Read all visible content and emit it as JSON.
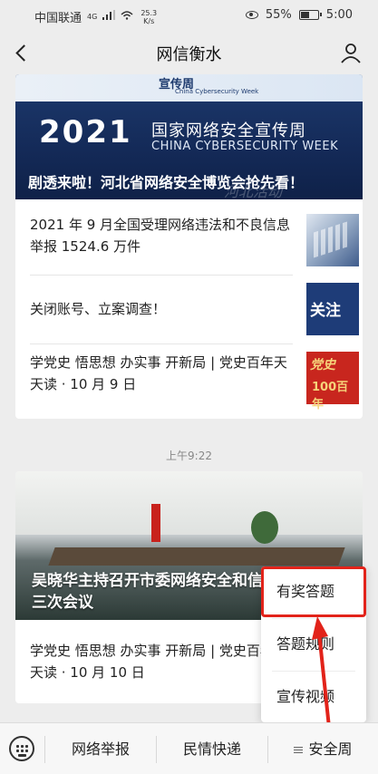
{
  "status_bar": {
    "carrier": "中国联通",
    "network": "4G",
    "speed_value": "25.3",
    "speed_unit": "K/s",
    "battery": "55%",
    "battery_level": 0.55,
    "time": "5:00"
  },
  "header": {
    "title": "网信衡水",
    "back_icon": "back-arrow-icon",
    "profile_icon": "user-icon"
  },
  "card1": {
    "hero": {
      "brand_cn": "宣传周",
      "brand_en": "China Cybersecurity Week",
      "year": "2021",
      "week_cn": "国家网络安全宣传周",
      "week_en": "CHINA CYBERSECURITY WEEK",
      "caption": "剧透来啦！河北省网络安全博览会抢先看！",
      "watermark": "河北活动"
    },
    "items": [
      {
        "text": "2021 年 9 月全国受理网络违法和不良信息举报 1524.6 万件",
        "thumb": "keyboard-photo"
      },
      {
        "text": "关闭账号、立案调查！",
        "thumb": "关注"
      },
      {
        "text": "学党史 悟思想 办实事 开新局 | 党史百年天天读 · 10 月 9 日",
        "thumb_top": "党史",
        "thumb_bottom": "100百年"
      }
    ]
  },
  "timestamp": "上午9:22",
  "card2": {
    "hero_caption": "吴晓华主持召开市委网络安全和信息化委员会第三次会议",
    "items": [
      {
        "text": "学党史 悟思想 办实事 开新局 | 党史百年天天读 · 10 月 10 日"
      }
    ]
  },
  "popup_menu": {
    "items": [
      "有奖答题",
      "答题规则",
      "宣传视频"
    ],
    "highlight_color": "#e2231a"
  },
  "bottom_bar": {
    "keyboard_icon": "keyboard-icon",
    "tabs": [
      "网络举报",
      "民情快递",
      "安全周"
    ]
  }
}
